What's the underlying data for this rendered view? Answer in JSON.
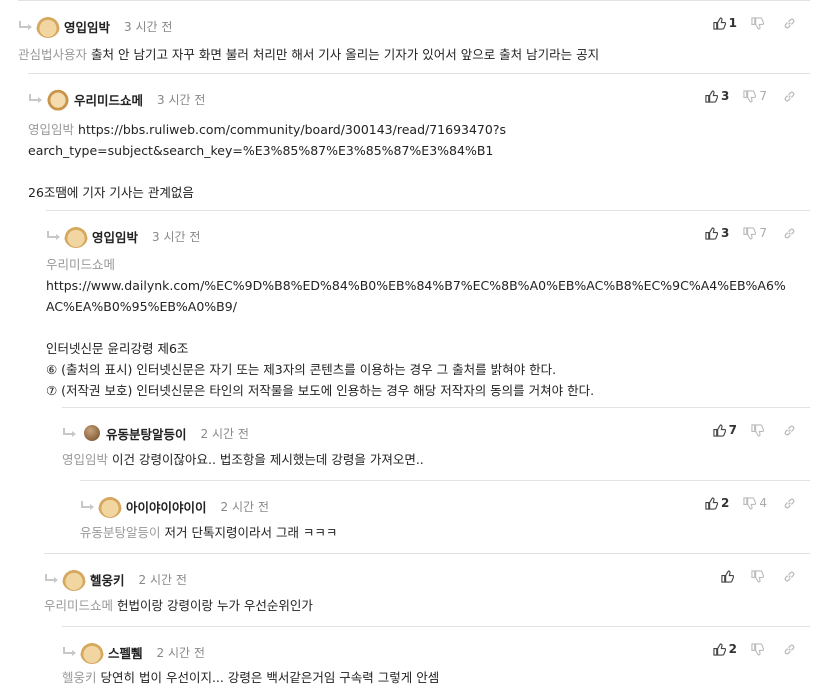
{
  "comments": [
    {
      "nick": "영입임박",
      "time": "3 시간 전",
      "up": "1",
      "down": "",
      "mention": "관심법사용자",
      "lines": [
        "출처 안 남기고 자꾸 화면 불러 처리만 해서 기사 올리는 기자가 있어서 앞으로 출처 남기라는 공지"
      ]
    },
    {
      "nick": "우리미드쇼메",
      "time": "3 시간 전",
      "up": "3",
      "down": "7",
      "mention": "영입임박",
      "url": "https://bbs.ruliweb.com/community/board/300143/read/71693470?search_type=subject&search_key=%E3%85%87%E3%85%87%E3%84%B1",
      "lines": [
        "26조땜에 기자 기사는 관계없음"
      ]
    },
    {
      "nick": "영입임박",
      "time": "3 시간 전",
      "up": "3",
      "down": "7",
      "mention": "우리미드쇼메",
      "url": "https://www.dailynk.com/%EC%9D%B8%ED%84%B0%EB%84%B7%EC%8B%A0%EB%AC%B8%EC%9C%A4%EB%A6%AC%EA%B0%95%EB%A0%B9/",
      "lines": [
        "인터넷신문 윤리강령 제6조",
        "⑥ (출처의 표시) 인터넷신문은 자기 또는 제3자의 콘텐츠를 이용하는 경우 그 출처를 밝혀야 한다.",
        "⑦ (저작권 보호) 인터넷신문은 타인의 저작물을 보도에 인용하는 경우 해당 저작자의 동의를 거쳐야 한다."
      ]
    },
    {
      "nick": "유동분탕알등이",
      "time": "2 시간 전",
      "up": "7",
      "down": "",
      "mention": "영입임박",
      "lines": [
        "이건 강령이잖아요.. 법조항을 제시했는데 강령을 가져오면.."
      ]
    },
    {
      "nick": "아이야이야이이",
      "time": "2 시간 전",
      "up": "2",
      "down": "4",
      "mention": "유동분탕알등이",
      "lines": [
        "저거 단톡지령이라서 그래 ㅋㅋㅋ"
      ]
    },
    {
      "nick": "헬웅키",
      "time": "2 시간 전",
      "up": "",
      "down": "",
      "mention": "우리미드쇼메",
      "lines": [
        "헌법이랑 강령이랑 누가 우선순위인가"
      ]
    },
    {
      "nick": "스펠쀔",
      "time": "2 시간 전",
      "up": "2",
      "down": "",
      "mention": "헬웅키",
      "lines": [
        "당연히 법이 우선이지... 강령은 백서같은거임 구속력 그렇게 안셈"
      ]
    }
  ]
}
